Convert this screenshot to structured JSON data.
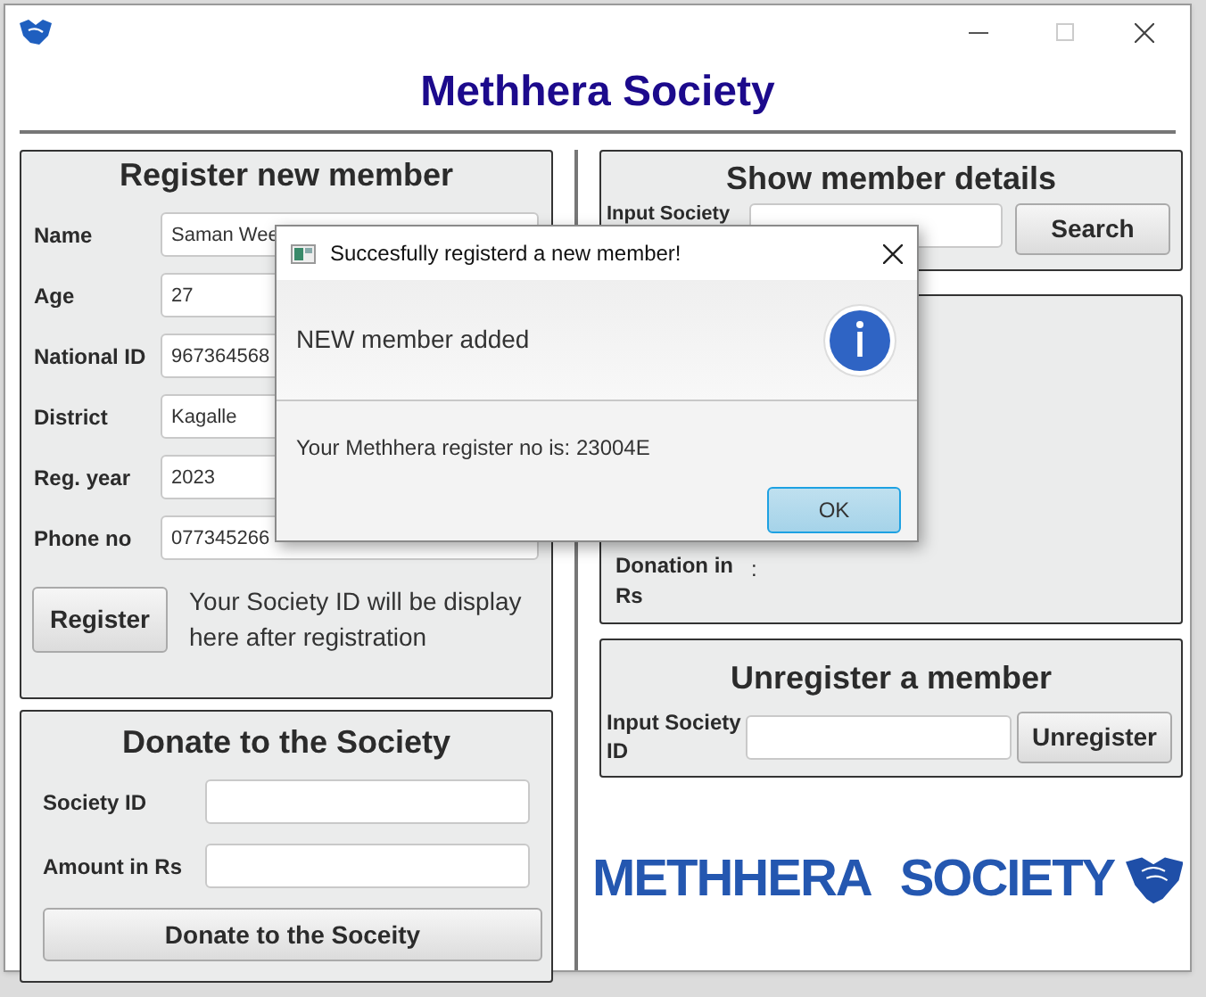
{
  "window": {
    "title": "Methhera Society"
  },
  "register": {
    "title": "Register new member",
    "fields": [
      {
        "label": "Name",
        "value": "Saman Wee"
      },
      {
        "label": "Age",
        "value": "27"
      },
      {
        "label": "National ID",
        "value": "967364568"
      },
      {
        "label": "District",
        "value": "Kagalle"
      },
      {
        "label": "Reg. year",
        "value": "2023"
      },
      {
        "label": "Phone no",
        "value": "077345266"
      }
    ],
    "button": "Register",
    "note": "Your Society ID will be display here after registration"
  },
  "donate": {
    "title": "Donate to the Society",
    "fields": [
      {
        "label": "Society ID"
      },
      {
        "label": "Amount in Rs"
      }
    ],
    "button": "Donate to the Soceity"
  },
  "show": {
    "title": "Show member details",
    "field_label": "Input Society",
    "button": "Search",
    "details": [
      {
        "label": "Donation in Rs",
        "separator": ":"
      }
    ]
  },
  "unregister": {
    "title": "Unregister a member",
    "field_label": "Input Society ID",
    "button": "Unregister"
  },
  "logo": {
    "words": [
      "METHHERA",
      "SOCIETY"
    ]
  },
  "dialog": {
    "title": "Succesfully registerd a new member!",
    "header": "NEW member added",
    "content": "Your Methhera register no is: 23004E",
    "button": "OK"
  }
}
